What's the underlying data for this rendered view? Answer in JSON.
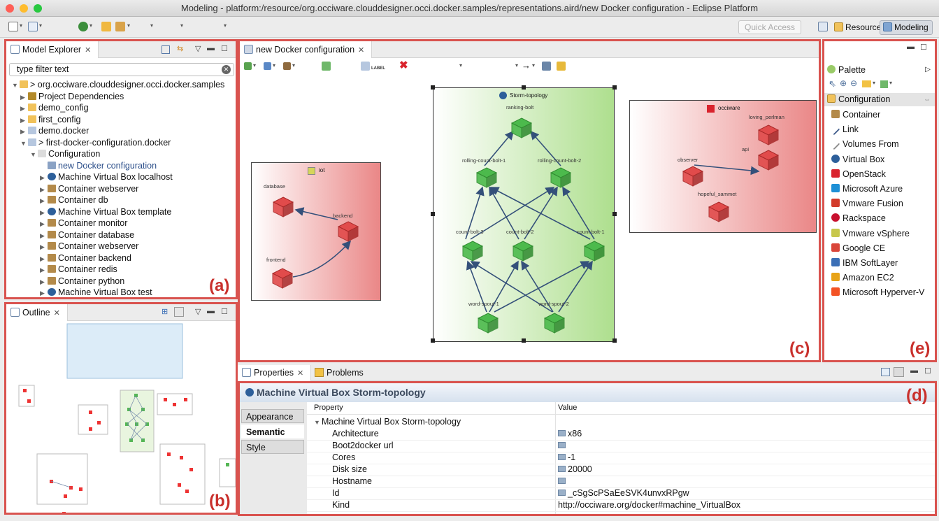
{
  "window": {
    "title": "Modeling - platform:/resource/org.occiware.clouddesigner.occi.docker.samples/representations.aird/new Docker configuration - Eclipse Platform"
  },
  "toolbar": {
    "quick_access_placeholder": "Quick Access",
    "perspectives": [
      "Resource",
      "Modeling"
    ]
  },
  "explorer": {
    "tab": "Model Explorer",
    "filter_placeholder": "type filter text",
    "label": "(a)",
    "tree": [
      {
        "label": "> org.occiware.clouddesigner.occi.docker.samples",
        "icon": "project-icon"
      },
      {
        "label": "Project Dependencies",
        "icon": "library-icon"
      },
      {
        "label": "demo_config",
        "icon": "folder-icon"
      },
      {
        "label": "first_config",
        "icon": "folder-icon"
      },
      {
        "label": "demo.docker",
        "icon": "file-icon"
      },
      {
        "label": "> first-docker-configuration.docker",
        "icon": "file-icon"
      },
      {
        "label": "Configuration",
        "icon": "configuration-icon"
      },
      {
        "label": "new Docker configuration",
        "icon": "diagram-icon"
      },
      {
        "label": "Machine Virtual Box localhost",
        "icon": "virtualbox-icon"
      },
      {
        "label": "Container webserver",
        "icon": "container-icon"
      },
      {
        "label": "Container db",
        "icon": "container-icon"
      },
      {
        "label": "Machine Virtual Box template",
        "icon": "virtualbox-icon"
      },
      {
        "label": "Container monitor",
        "icon": "container-icon"
      },
      {
        "label": "Container database",
        "icon": "container-icon"
      },
      {
        "label": "Container webserver",
        "icon": "container-icon"
      },
      {
        "label": "Container backend",
        "icon": "container-icon"
      },
      {
        "label": "Container redis",
        "icon": "container-icon"
      },
      {
        "label": "Container python",
        "icon": "container-icon"
      },
      {
        "label": "Machine Virtual Box test",
        "icon": "virtualbox-icon"
      }
    ]
  },
  "outline": {
    "tab": "Outline",
    "label": "(b)"
  },
  "editor": {
    "tab": "new Docker configuration",
    "label": "(c)",
    "toolbar_label_text": "LABEL",
    "iot": {
      "name": "iot",
      "containers": [
        "database",
        "backend",
        "frontend"
      ]
    },
    "storm": {
      "name": "Storm-topology",
      "containers": [
        "ranking-bolt",
        "rolling-count-bolt-1",
        "rolling-count-bolt-2",
        "count-bolt-3",
        "count-bolt-2",
        "count-bolt-1",
        "word-spout-1",
        "word-spout-2"
      ]
    },
    "occiware": {
      "name": "occiware",
      "containers": [
        "loving_perlman",
        "api",
        "observer",
        "hopeful_sammet"
      ]
    }
  },
  "properties": {
    "tabs": [
      "Properties",
      "Problems"
    ],
    "label": "(d)",
    "title": "Machine Virtual Box Storm-topology",
    "section_tabs": [
      "Appearance",
      "Semantic",
      "Style"
    ],
    "selected_section": "Semantic",
    "columns": [
      "Property",
      "Value"
    ],
    "group": "Machine Virtual Box Storm-topology",
    "rows": [
      {
        "property": "Architecture",
        "value": "x86"
      },
      {
        "property": "Boot2docker url",
        "value": ""
      },
      {
        "property": "Cores",
        "value": "-1"
      },
      {
        "property": "Disk size",
        "value": "20000"
      },
      {
        "property": "Hostname",
        "value": ""
      },
      {
        "property": "Id",
        "value": "_cSgScPSaEeSVK4unvxRPgw"
      },
      {
        "property": "Kind",
        "value": "http://occiware.org/docker#machine_VirtualBox"
      }
    ]
  },
  "palette": {
    "title": "Palette",
    "label": "(e)",
    "group": "Configuration",
    "items": [
      {
        "label": "Container",
        "icon": "container-icon",
        "color": "#b38a4a"
      },
      {
        "label": "Link",
        "icon": "link-icon",
        "color": "#3d5a8a"
      },
      {
        "label": "Volumes From",
        "icon": "volumes-icon",
        "color": "#888888"
      },
      {
        "label": "Virtual Box",
        "icon": "virtualbox-icon",
        "color": "#2d5f9a"
      },
      {
        "label": "OpenStack",
        "icon": "openstack-icon",
        "color": "#d9232d"
      },
      {
        "label": "Microsoft Azure",
        "icon": "azure-icon",
        "color": "#1e90d6"
      },
      {
        "label": "Vmware Fusion",
        "icon": "vmware-fusion-icon",
        "color": "#d23b2b"
      },
      {
        "label": "Rackspace",
        "icon": "rackspace-icon",
        "color": "#c8102e"
      },
      {
        "label": "Vmware vSphere",
        "icon": "vsphere-icon",
        "color": "#c7c74c"
      },
      {
        "label": "Google CE",
        "icon": "google-ce-icon",
        "color": "#d9453a"
      },
      {
        "label": "IBM SoftLayer",
        "icon": "softlayer-icon",
        "color": "#3b6fb6"
      },
      {
        "label": "Amazon EC2",
        "icon": "ec2-icon",
        "color": "#e8a317"
      },
      {
        "label": "Microsoft Hyperver-V",
        "icon": "hyperv-icon",
        "color": "#f35325"
      }
    ]
  }
}
